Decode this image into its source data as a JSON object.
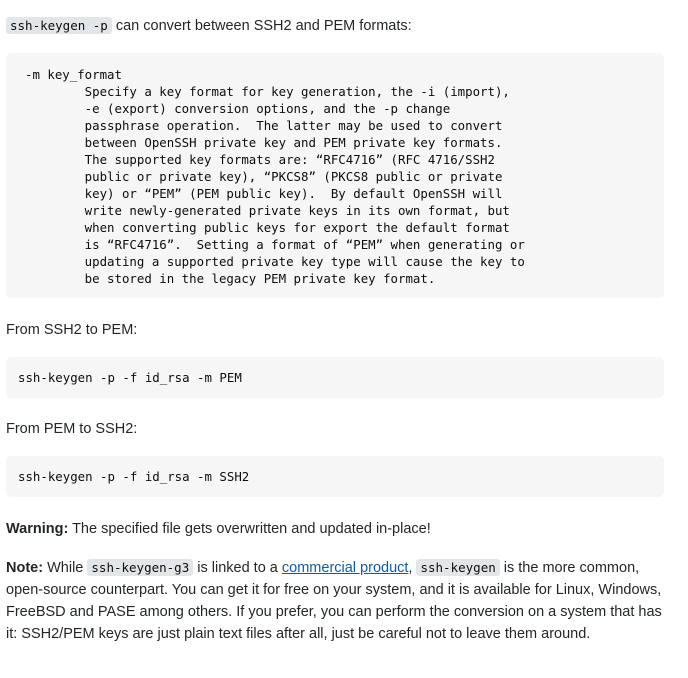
{
  "intro": {
    "code": "ssh-keygen -p",
    "text": " can convert between SSH2 and PEM formats:"
  },
  "man_block": {
    "text": "-m key_format\n        Specify a key format for key generation, the -i (import),\n        -e (export) conversion options, and the -p change\n        passphrase operation.  The latter may be used to convert\n        between OpenSSH private key and PEM private key formats.\n        The supported key formats are: “RFC4716” (RFC 4716/SSH2\n        public or private key), “PKCS8” (PKCS8 public or private\n        key) or “PEM” (PEM public key).  By default OpenSSH will\n        write newly-generated private keys in its own format, but\n        when converting public keys for export the default format\n        is “RFC4716”.  Setting a format of “PEM” when generating or\n        updating a supported private key type will cause the key to\n        be stored in the legacy PEM private key format."
  },
  "section1": {
    "label": "From SSH2 to PEM:",
    "command": "ssh-keygen -p -f id_rsa -m PEM"
  },
  "section2": {
    "label": "From PEM to SSH2:",
    "command": "ssh-keygen -p -f id_rsa -m SSH2"
  },
  "warning": {
    "label": "Warning:",
    "text": " The specified file gets overwritten and updated in-place!"
  },
  "note": {
    "label": "Note:",
    "t1": " While ",
    "code1": "ssh-keygen-g3",
    "t2": " is linked to a ",
    "link": "commercial product",
    "t3": ", ",
    "code2": "ssh-keygen",
    "t4": " is the more common, open-source counterpart. You can get it for free on your system, and it is available for Linux, Windows, FreeBSD and PASE among others. If you prefer, you can perform the conversion on a system that has it: SSH2/PEM keys are just plain text files after all, just be careful not to leave them around."
  }
}
